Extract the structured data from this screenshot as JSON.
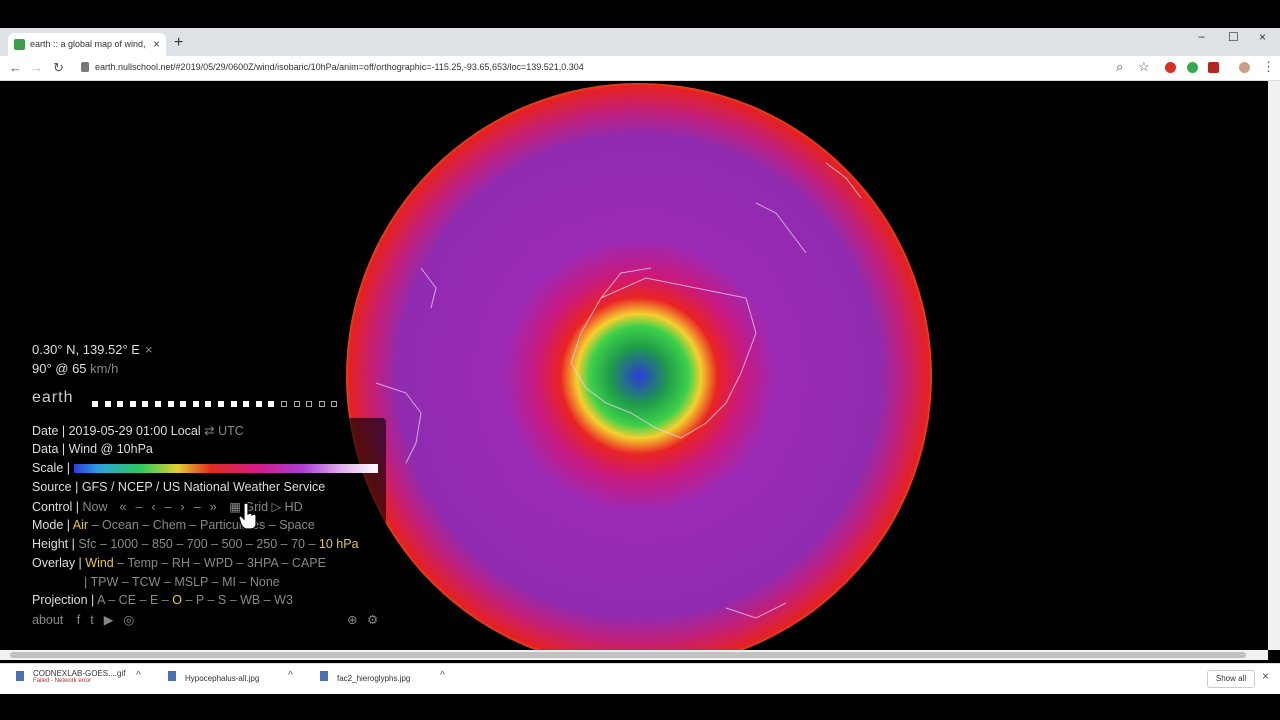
{
  "browser": {
    "tab_title": "earth :: a global map of wind, we",
    "new_tab": "+",
    "tab_close": "×",
    "url": "earth.nullschool.net/#2019/05/29/0600Z/wind/isobaric/10hPa/anim=off/orthographic=-115.25,-93.65,653/loc=139.521,0.304",
    "window_controls": [
      "−",
      "☐",
      "×"
    ],
    "nav": {
      "back": "←",
      "forward": "→",
      "reload": "↻"
    },
    "toolbar_icons": {
      "zoom": "⌕",
      "bookmark": "☆",
      "menu": "⋮"
    }
  },
  "readout": {
    "location": "0.30° N, 139.52° E",
    "close": "×",
    "wind_value": "90° @ 65",
    "wind_unit": "km/h"
  },
  "brand": "earth",
  "progress": {
    "total": 20,
    "filled": 15
  },
  "menu": {
    "date_label": "Date |",
    "date_value": "2019-05-29 01:00 Local",
    "date_toggle": "⇄",
    "date_utc": "UTC",
    "data_label": "Data |",
    "data_value": "Wind @ 10hPa",
    "scale_label": "Scale |",
    "source_label": "Source |",
    "source_value": "GFS / NCEP / US National Weather Service",
    "control_label": "Control |",
    "control_items": [
      "Now",
      "«",
      "–",
      "‹",
      "–",
      "›",
      "–",
      "»"
    ],
    "control_calendar": "▦",
    "control_grid": "Grid",
    "control_play": "▷",
    "control_hd": "HD",
    "mode_label": "Mode |",
    "mode_items": [
      "Air",
      "Ocean",
      "Chem",
      "Particulates",
      "Space"
    ],
    "mode_selected": "Air",
    "height_label": "Height |",
    "height_items": [
      "Sfc",
      "1000",
      "850",
      "700",
      "500",
      "250",
      "70",
      "10"
    ],
    "height_selected": "10",
    "height_unit": "hPa",
    "overlay_label": "Overlay |",
    "overlay_items_1": [
      "Wind",
      "Temp",
      "RH",
      "WPD",
      "3HPA",
      "CAPE"
    ],
    "overlay_items_2": [
      "TPW",
      "TCW",
      "MSLP",
      "MI",
      "None"
    ],
    "overlay_selected": "Wind",
    "projection_label": "Projection |",
    "projection_items": [
      "A",
      "CE",
      "E",
      "O",
      "P",
      "S",
      "WB",
      "W3"
    ],
    "projection_selected": "O",
    "about": "about",
    "social_icons": [
      "facebook-icon",
      "twitter-icon",
      "youtube-icon",
      "instagram-icon"
    ],
    "social_glyphs": [
      "f",
      "t",
      "▶",
      "◎"
    ],
    "bottom_glyphs": [
      "⊕",
      "⚙"
    ]
  },
  "downloads": {
    "items": [
      {
        "name": "CODNEXLAB-GOES....gif",
        "status": "Failed - Network error"
      },
      {
        "name": "Hypocephalus-all.jpg",
        "status": ""
      },
      {
        "name": "fac2_hieroglyphs.jpg",
        "status": ""
      }
    ],
    "arrow": "^",
    "show_all": "Show all",
    "close": "×"
  }
}
